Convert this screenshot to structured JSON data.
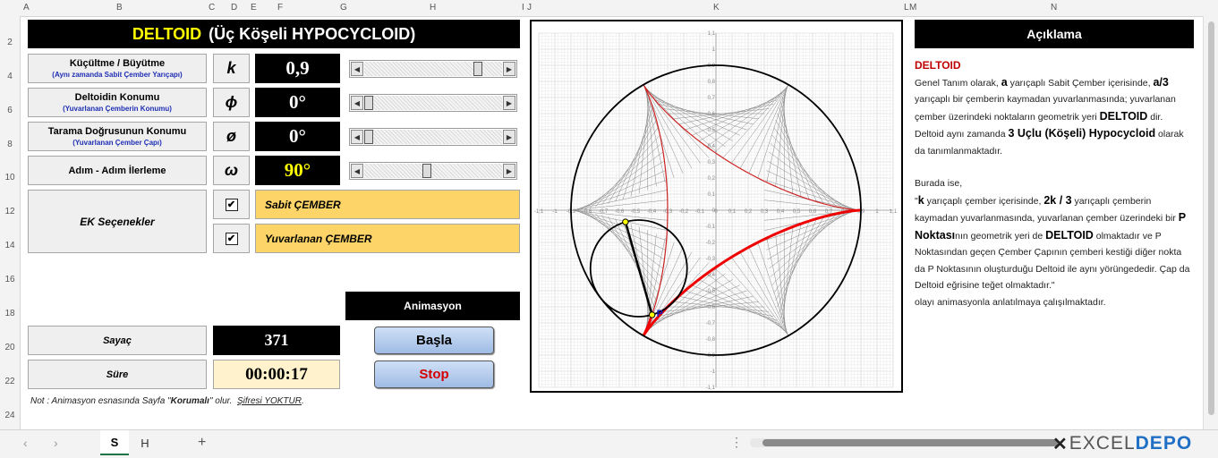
{
  "columns": [
    "A",
    "B",
    "C",
    "D",
    "E",
    "F",
    "G",
    "H",
    "I",
    "J",
    "K",
    "L",
    "M",
    "N"
  ],
  "rows": [
    "2",
    "4",
    "6",
    "8",
    "10",
    "12",
    "14",
    "16",
    "18",
    "20",
    "22",
    "24"
  ],
  "title": {
    "main": "DELTOID",
    "sub": "(Üç Köşeli HYPOCYCLOID)"
  },
  "controls": [
    {
      "label": "Küçültme / Büyütme",
      "sub": "(Aynı zamanda Sabit Çember Yarıçapı)",
      "symbol": "k",
      "value": "0,9",
      "slider": 0.85
    },
    {
      "label": "Deltoidin Konumu",
      "sub": "(Yuvarlanan Çemberin Konumu)",
      "symbol": "ϕ",
      "value": "0°",
      "slider": 0.0
    },
    {
      "label": "Tarama Doğrusunun Konumu",
      "sub": "(Yuvarlanan Çember Çapı)",
      "symbol": "ø",
      "value": "0°",
      "slider": 0.0
    },
    {
      "label": "Adım - Adım İlerleme",
      "sub": "",
      "symbol": "ω",
      "value": "90°",
      "slider": 0.45
    }
  ],
  "extra": {
    "label": "EK Seçenekler",
    "options": [
      {
        "label": "Sabit ÇEMBER",
        "checked": "✔"
      },
      {
        "label": "Yuvarlanan ÇEMBER",
        "checked": "✔"
      }
    ]
  },
  "animation": {
    "header": "Animasyon",
    "start": "Başla",
    "stop": "Stop"
  },
  "counter": {
    "label": "Sayaç",
    "value": "371"
  },
  "duration": {
    "label": "Süre",
    "value": "00:00:17"
  },
  "note": {
    "prefix": "Not : Animasyon esnasında Sayfa \"",
    "bold": "Korumalı",
    "mid": "\" olur.",
    "link": "Şifresi YOKTUR",
    "suffix": "."
  },
  "chart": {
    "point_label": "P",
    "ticks": [
      "-1,1",
      "-1",
      "-0,9",
      "-0,8",
      "-0,7",
      "-0,6",
      "-0,5",
      "-0,4",
      "-0,3",
      "-0,2",
      "-0,1",
      "0",
      "0,1",
      "0,2",
      "0,3",
      "0,4",
      "0,5",
      "0,6",
      "0,7",
      "0,8",
      "0,9",
      "1",
      "1,1"
    ]
  },
  "description": {
    "header": "Açıklama",
    "title": "DELTOID",
    "p1": [
      "Genel Tanım olarak, ",
      "a",
      " yarıçaplı Sabit Çember içerisinde, ",
      "a/3",
      " yarıçaplı bir çemberin kaymadan yuvarlanmasında; yuvarlanan çember üzerindeki noktaların geometrik yeri ",
      "DELTOID",
      " dir. Deltoid aynı zamanda ",
      "3 Uçlu (Köşeli) Hypocycloid",
      " olarak da tanımlanmaktadır."
    ],
    "p2": [
      "Burada ise,",
      "\"",
      "k",
      " yarıçaplı çember içerisinde, ",
      "2k / 3",
      " yarıçaplı çemberin kaymadan yuvarlanmasında, yuvarlanan çember üzerindeki bir ",
      "P Noktası",
      "nın geometrik yeri de ",
      "DELTOID",
      " olmaktadır ve P Noktasından geçen Çember Çapının çemberi kestiği diğer nokta da P Noktasının oluşturduğu Deltoid ile aynı yörüngededir. Çap da Deltoid eğrisine teğet olmaktadır.\"",
      "olayı animasyonla anlatılmaya çalışılmaktadır."
    ]
  },
  "tabs": [
    {
      "label": "S",
      "active": true
    },
    {
      "label": "H",
      "active": false
    }
  ],
  "tab_add": "+",
  "logo": {
    "text": "EXCELDEPO",
    "colors": {
      "excel": "#555555",
      "depo": "#1f6fc5"
    }
  }
}
